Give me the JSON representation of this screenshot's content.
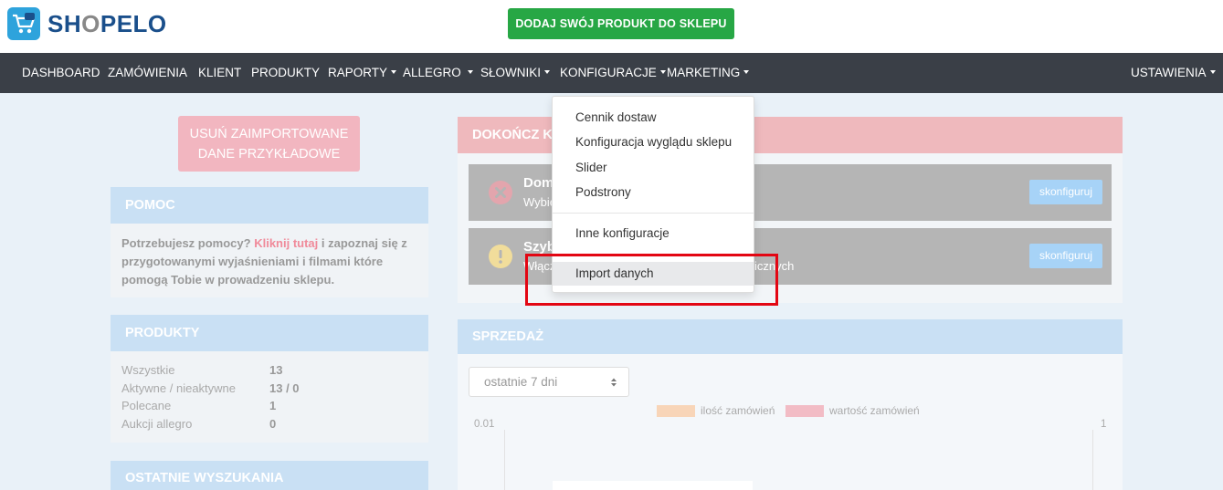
{
  "header": {
    "logo_text_a": "SH",
    "logo_text_b": "O",
    "logo_text_c": "PELO",
    "add_product_label": "DODAJ SWÓJ PRODUKT DO SKLEPU"
  },
  "nav": {
    "items": [
      {
        "label": "DASHBOARD"
      },
      {
        "label": "ZAMÓWIENIA"
      },
      {
        "label": "KLIENT"
      },
      {
        "label": "PRODUKTY"
      },
      {
        "label": "RAPORTY"
      },
      {
        "label": "ALLEGRO"
      },
      {
        "label": "SŁOWNIKI"
      },
      {
        "label": "KONFIGURACJE"
      },
      {
        "label": "MARKETING"
      },
      {
        "label": "USTAWIENIA"
      }
    ]
  },
  "left": {
    "remove_btn_line1": "USUŃ ZAIMPORTOWANE",
    "remove_btn_line2": "DANE PRZYKŁADOWE",
    "help": {
      "title": "POMOC",
      "text_before": "Potrzebujesz pomocy? ",
      "link": "Kliknij tutaj",
      "text_after": " i zapoznaj się z przygotowanymi wyjaśnieniami i filmami które pomogą Tobie w prowadzeniu sklepu."
    },
    "products": {
      "title": "PRODUKTY",
      "rows": [
        {
          "label": "Wszystkie",
          "value": "13"
        },
        {
          "label": "Aktywne / nieaktywne",
          "value": "13 / 0"
        },
        {
          "label": "Polecane",
          "value": "1"
        },
        {
          "label": "Aukcji allegro",
          "value": "0"
        }
      ]
    },
    "searches_title": "OSTATNIE WYSZUKANIA"
  },
  "finish": {
    "title": "DOKOŃCZ K",
    "tasks": [
      {
        "title": "Dom",
        "desc": "Wybie",
        "button": "skonfiguruj"
      },
      {
        "title": "Szyb",
        "desc": "Włącz",
        "desc_tail": "icznych",
        "button": "skonfiguruj"
      }
    ]
  },
  "sales": {
    "title": "SPRZEDAŻ",
    "period": "ostatnie 7 dni"
  },
  "dropdown": {
    "items": [
      "Cennik dostaw",
      "Konfiguracja wyglądu sklepu",
      "Slider",
      "Podstrony",
      "Inne konfiguracje",
      "Import danych"
    ]
  },
  "colors": {
    "navbar": "#3a3f47",
    "green": "#27a745",
    "highlight": "#e30613",
    "series1": "#f8d5b8",
    "series2": "#f2bcc5"
  },
  "chart_data": {
    "type": "bar",
    "series": [
      {
        "name": "ilość zamówień",
        "values": []
      },
      {
        "name": "wartość zamówień",
        "values": []
      }
    ],
    "y_left_top": "0.01",
    "y_right_top": "1"
  }
}
